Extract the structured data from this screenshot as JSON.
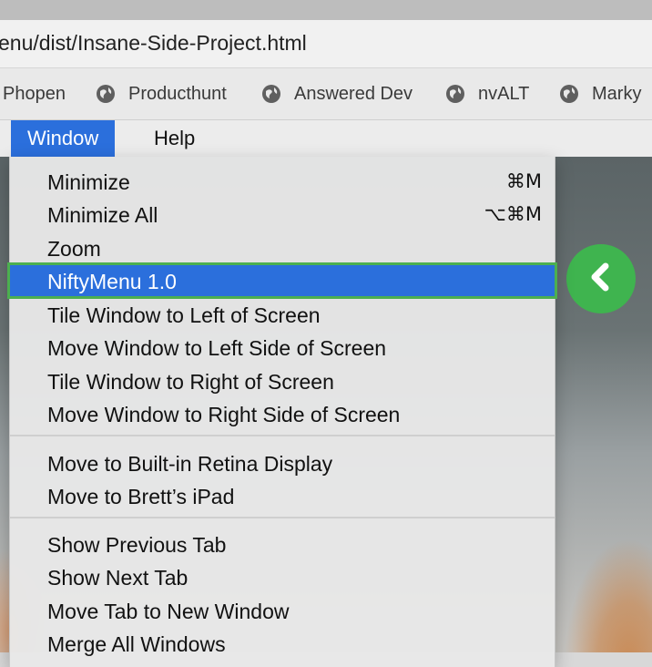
{
  "browser": {
    "url": "enu/dist/Insane-Side-Project.html"
  },
  "bookmarks": [
    {
      "label": "Phopen",
      "icon": "none"
    },
    {
      "label": "Producthunt",
      "icon": "globe-icon"
    },
    {
      "label": "Answered Dev",
      "icon": "globe-icon"
    },
    {
      "label": "nvALT",
      "icon": "globe-icon"
    },
    {
      "label": "Marky",
      "icon": "globe-icon"
    }
  ],
  "menubar": {
    "window": "Window",
    "help": "Help"
  },
  "menu": {
    "group1": [
      {
        "label": "Minimize",
        "shortcut": "⌘M"
      },
      {
        "label": "Minimize All",
        "shortcut": "⌥⌘M"
      },
      {
        "label": "Zoom",
        "shortcut": ""
      },
      {
        "label": "NiftyMenu 1.0",
        "shortcut": "",
        "highlighted": true
      },
      {
        "label": "Tile Window to Left of Screen",
        "shortcut": ""
      },
      {
        "label": "Move Window to Left Side of Screen",
        "shortcut": ""
      },
      {
        "label": "Tile Window to Right of Screen",
        "shortcut": ""
      },
      {
        "label": "Move Window to Right Side of Screen",
        "shortcut": ""
      }
    ],
    "group2": [
      {
        "label": "Move to Built-in Retina Display"
      },
      {
        "label": "Move to Brett’s iPad"
      }
    ],
    "group3": [
      {
        "label": "Show Previous Tab"
      },
      {
        "label": "Show Next Tab"
      },
      {
        "label": "Move Tab to New Window"
      },
      {
        "label": "Merge All Windows"
      }
    ]
  },
  "colors": {
    "menu_highlight": "#2b6fdc",
    "highlight_outline": "#4caf50",
    "nav_button": "#3fb44f"
  }
}
